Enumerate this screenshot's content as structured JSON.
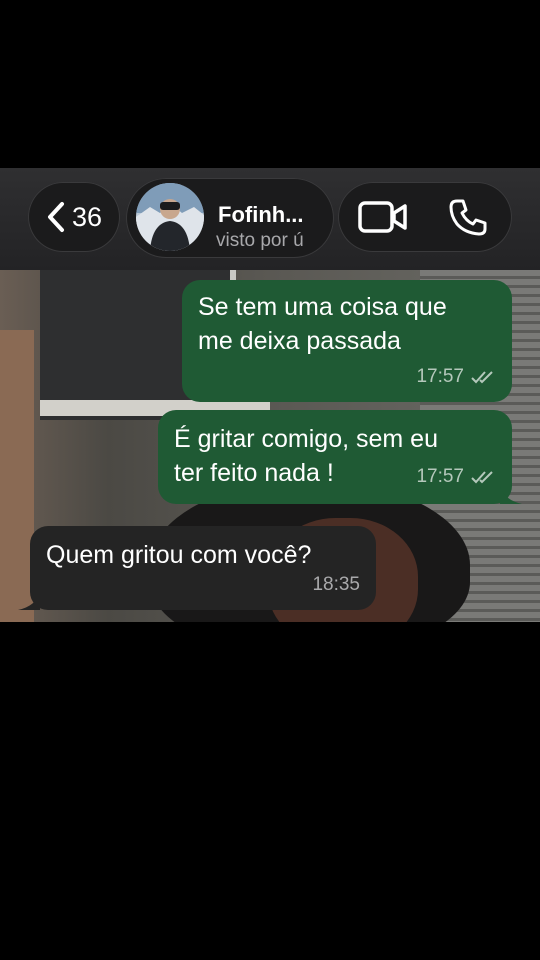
{
  "header": {
    "back_count": "36",
    "contact_name": "Fofinh...",
    "contact_status": "visto por ú"
  },
  "messages": [
    {
      "direction": "outgoing",
      "text_line1": "Se tem uma coisa que",
      "text_line2": "me deixa passada",
      "time": "17:57",
      "status": "read"
    },
    {
      "direction": "outgoing",
      "text_line1": "É gritar comigo, sem eu",
      "text_line2": "ter feito nada !",
      "time": "17:57",
      "status": "read"
    },
    {
      "direction": "incoming",
      "text_line1": "Quem gritou com você?",
      "time": "18:35"
    }
  ],
  "colors": {
    "outgoing_bubble": "#1f5a34",
    "incoming_bubble": "#242424",
    "header_bg": "#2a2a2c"
  },
  "icons": [
    "chevron-left-icon",
    "video-camera-icon",
    "phone-icon",
    "double-check-icon"
  ]
}
